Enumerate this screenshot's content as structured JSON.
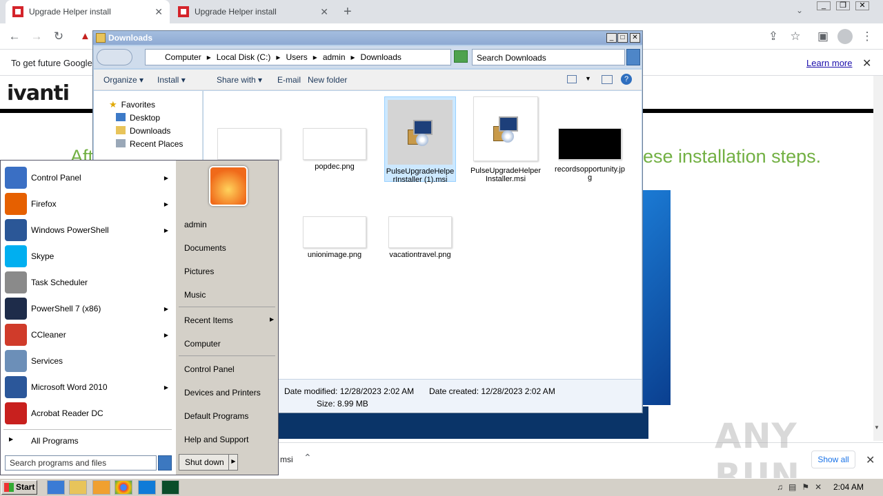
{
  "browser": {
    "tabs": [
      {
        "title": "Upgrade Helper install",
        "active": true
      },
      {
        "title": "Upgrade Helper install",
        "active": false
      }
    ],
    "new_tab_icon": "plus-icon",
    "infobar_text": "To get future Google",
    "learn_more": "Learn more"
  },
  "page": {
    "logo": "ivanti",
    "headline_left": "Aft",
    "headline_right": "ese installation steps."
  },
  "explorer": {
    "title": "Downloads",
    "breadcrumb": [
      "Computer",
      "Local Disk (C:)",
      "Users",
      "admin",
      "Downloads"
    ],
    "search_placeholder": "Search Downloads",
    "commands": [
      "Organize",
      "Install",
      "Share with",
      "E-mail",
      "New folder"
    ],
    "nav": {
      "favorites": "Favorites",
      "items": [
        "Desktop",
        "Downloads",
        "Recent Places"
      ]
    },
    "files": [
      {
        "name": "popdec.png",
        "kind": "png"
      },
      {
        "name": "PulseUpgradeHelperInstaller (1).msi",
        "kind": "msi",
        "selected": true
      },
      {
        "name": "PulseUpgradeHelperInstaller.msi",
        "kind": "msi"
      },
      {
        "name": "recordsopportunity.jpg",
        "kind": "jpg"
      },
      {
        "name": "unionimage.png",
        "kind": "png"
      },
      {
        "name": "vacationtravel.png",
        "kind": "png"
      }
    ],
    "details": {
      "modified_label": "Date modified:",
      "modified": "12/28/2023 2:02 AM",
      "created_label": "Date created:",
      "created": "12/28/2023 2:02 AM",
      "size_label": "Size:",
      "size": "8.99 MB"
    }
  },
  "start_menu": {
    "programs": [
      {
        "label": "Control Panel",
        "arrow": true,
        "color": "#3a6fc4"
      },
      {
        "label": "Firefox",
        "arrow": true,
        "color": "#e66000"
      },
      {
        "label": "Windows PowerShell",
        "arrow": true,
        "color": "#2b5797"
      },
      {
        "label": "Skype",
        "arrow": false,
        "color": "#00aff0"
      },
      {
        "label": "Task Scheduler",
        "arrow": false,
        "color": "#8a8a8a"
      },
      {
        "label": "PowerShell 7 (x86)",
        "arrow": true,
        "color": "#1e2c4a"
      },
      {
        "label": "CCleaner",
        "arrow": true,
        "color": "#d03b2a"
      },
      {
        "label": "Services",
        "arrow": false,
        "color": "#6c8fb8"
      },
      {
        "label": "Microsoft Word 2010",
        "arrow": true,
        "color": "#2b579a"
      },
      {
        "label": "Acrobat Reader DC",
        "arrow": false,
        "color": "#c8201e"
      }
    ],
    "all_programs": "All Programs",
    "search_placeholder": "Search programs and files",
    "right": [
      "admin",
      "Documents",
      "Pictures",
      "Music",
      "Recent Items",
      "Computer",
      "Control Panel",
      "Devices and Printers",
      "Default Programs",
      "Help and Support"
    ],
    "shutdown": "Shut down"
  },
  "download_bar": {
    "file_fragment": "msi",
    "show_all": "Show all"
  },
  "taskbar": {
    "start": "Start",
    "clock": "2:04 AM"
  },
  "watermark": "ANY RUN"
}
